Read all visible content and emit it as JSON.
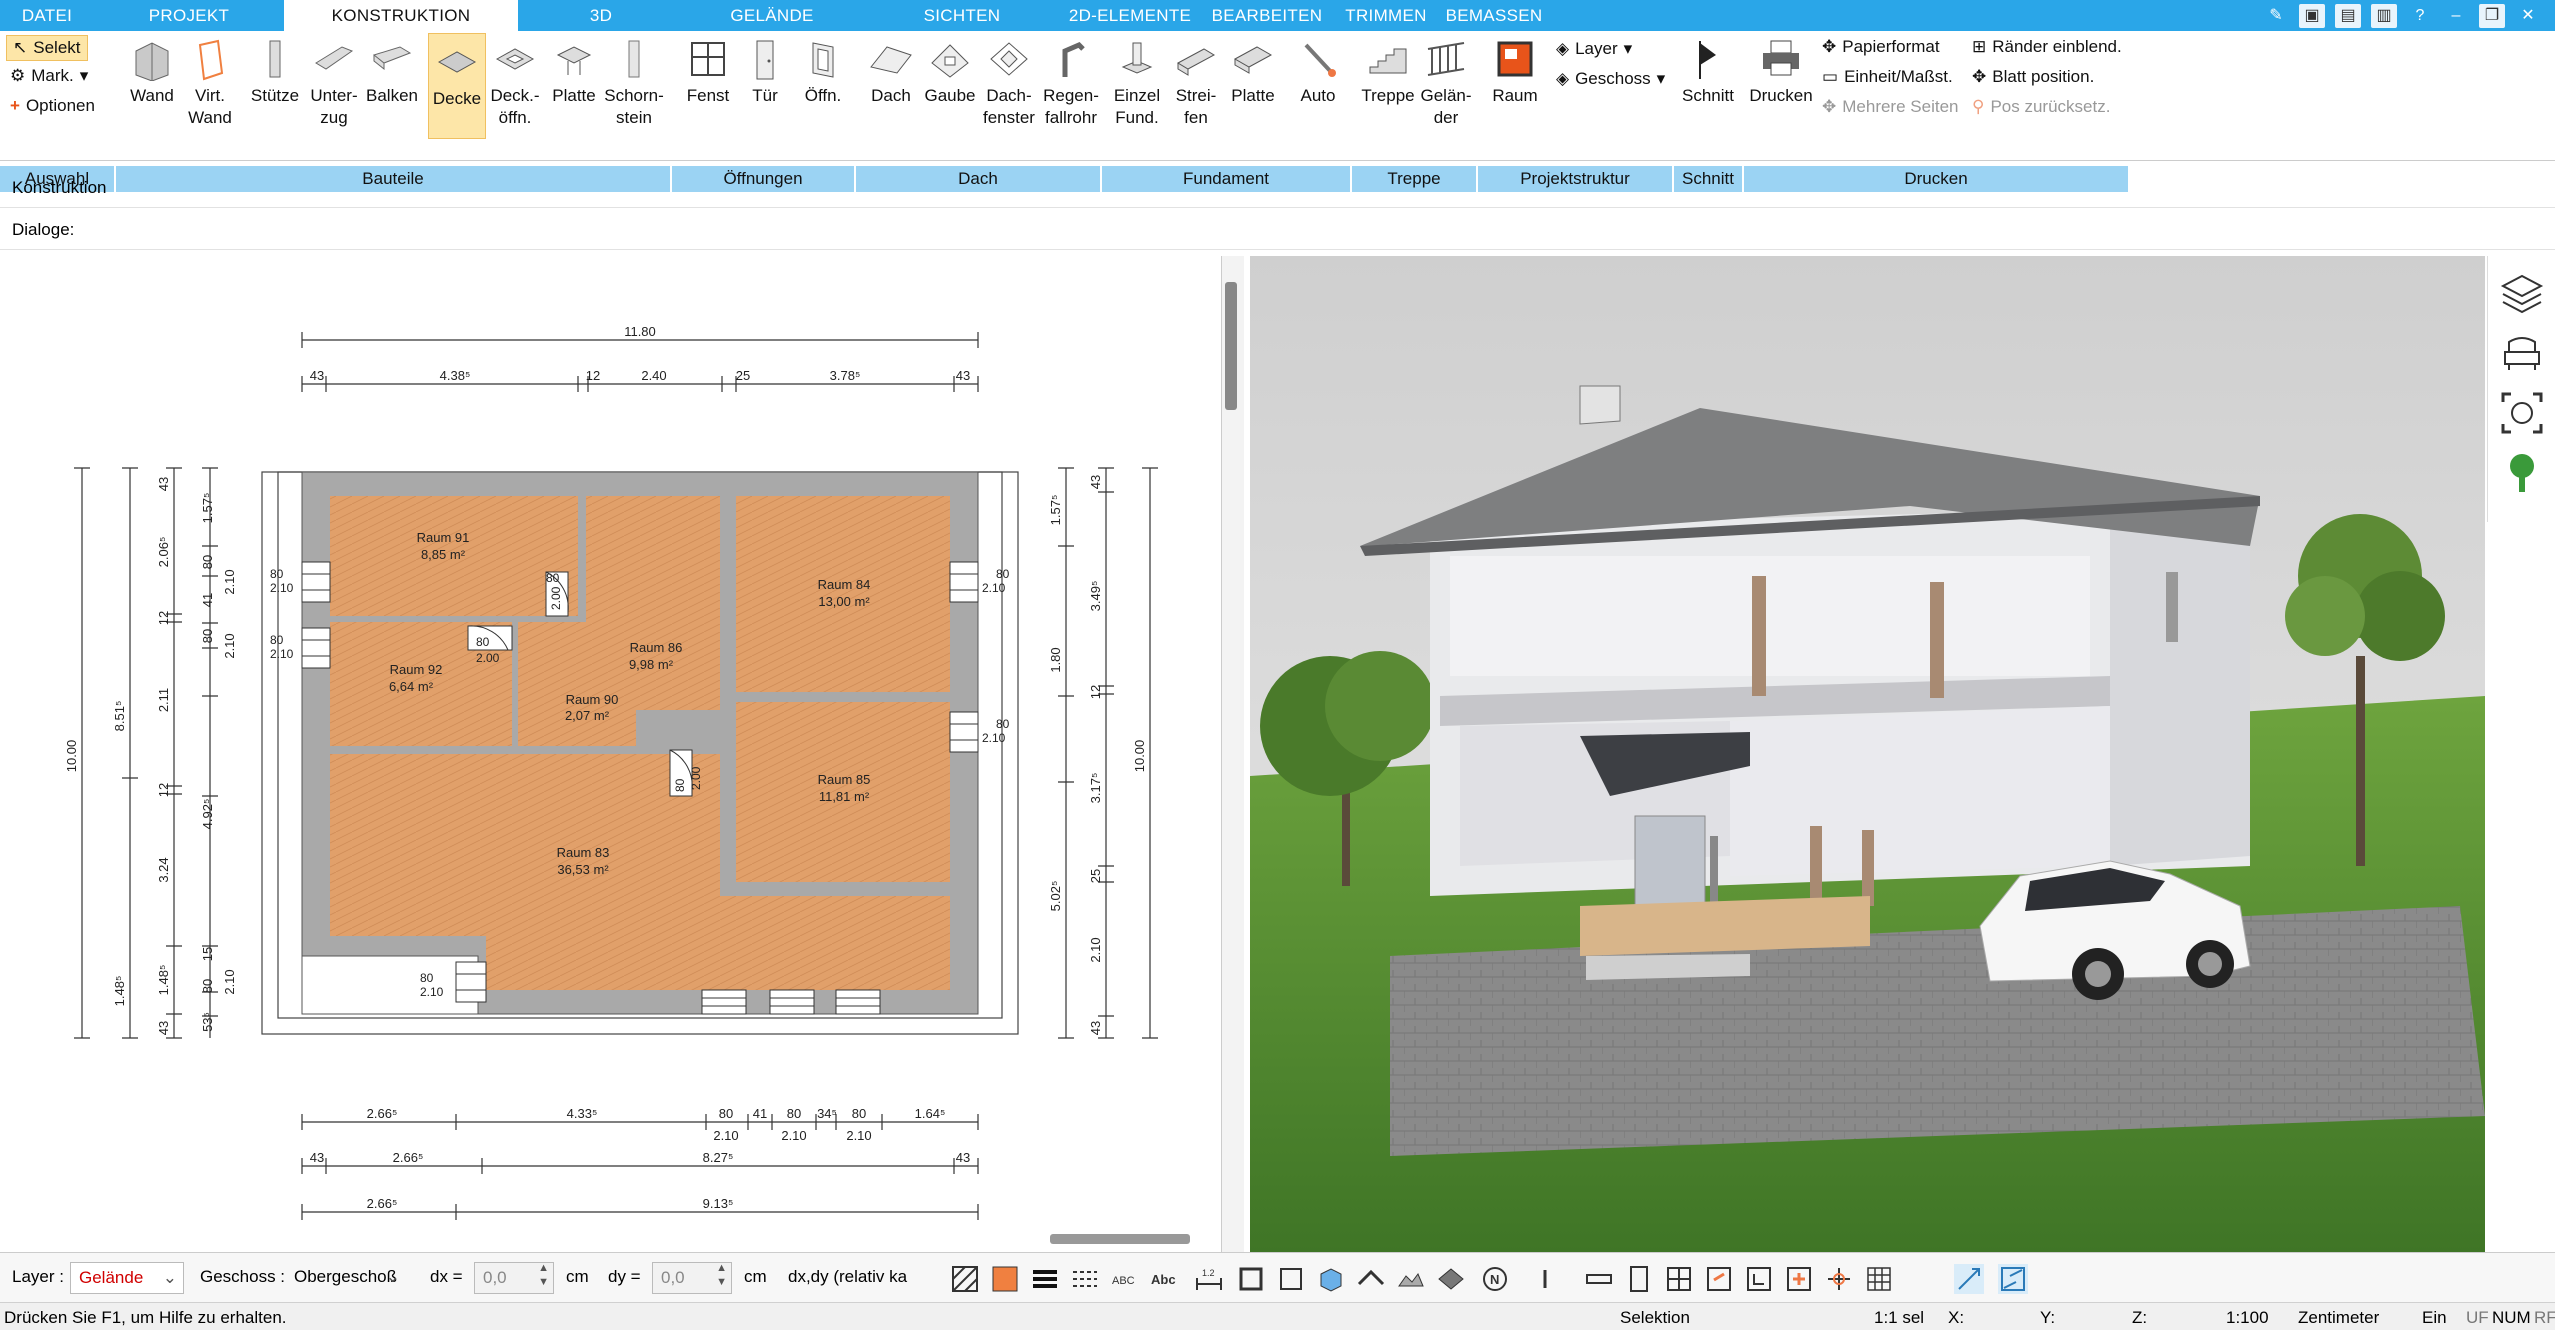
{
  "tabs": [
    "DATEI",
    "PROJEKT",
    "KONSTRUKTION",
    "3D",
    "GELÄNDE",
    "SICHTEN",
    "2D-ELEMENTE",
    "BEARBEITEN",
    "TRIMMEN",
    "BEMASSEN"
  ],
  "active_tab": "KONSTRUKTION",
  "auswahl": {
    "selekt": "Selekt",
    "mark": "Mark.",
    "optionen": "Optionen"
  },
  "buttons": {
    "wand": "Wand",
    "virt_wand": "Virt. Wand",
    "stuetze": "Stütze",
    "unterzug": "Unter- zug",
    "balken": "Balken",
    "decke": "Decke",
    "deckoeffn": "Deck.- öffn.",
    "platte": "Platte",
    "schornstein": "Schorn- stein",
    "fenst": "Fenst",
    "tuer": "Tür",
    "oeffn": "Öffn.",
    "dach": "Dach",
    "gaube": "Gaube",
    "dachfenster": "Dach- fenster",
    "regenfallrohr": "Regen- fallrohr",
    "einzel_fund": "Einzel Fund.",
    "streifen": "Strei- fen",
    "platte2": "Platte",
    "auto": "Auto",
    "treppe": "Treppe",
    "gelaender": "Gelän- der",
    "raum": "Raum",
    "layer": "Layer",
    "geschoss": "Geschoss",
    "schnitt": "Schnitt",
    "drucken": "Drucken",
    "papierformat": "Papierformat",
    "einheit": "Einheit/Maßst.",
    "mehrere_seiten": "Mehrere Seiten",
    "raender": "Ränder einblend.",
    "blatt": "Blatt position.",
    "pos_zurueck": "Pos zurücksetz."
  },
  "groups": [
    "Auswahl",
    "Bauteile",
    "Öffnungen",
    "Dach",
    "Fundament",
    "Treppe",
    "Projektstruktur",
    "Schnitt",
    "Drucken"
  ],
  "rows": {
    "konstruktion": "Konstruktion",
    "dialoge": "Dialoge:"
  },
  "rooms": [
    {
      "name": "Raum 91",
      "area": "8,85 m²"
    },
    {
      "name": "Raum 86",
      "area": "9,98 m²"
    },
    {
      "name": "Raum 84",
      "area": "13,00 m²"
    },
    {
      "name": "Raum 92",
      "area": "6,64 m²"
    },
    {
      "name": "Raum 90",
      "area": "2,07 m²"
    },
    {
      "name": "Raum 85",
      "area": "11,81 m²"
    },
    {
      "name": "Raum 83",
      "area": "36,53 m²"
    }
  ],
  "dims": {
    "top_total": "11.80",
    "top_row": [
      "43",
      "4.38⁵",
      "12",
      "2.40",
      "25",
      "3.78⁵",
      "43"
    ],
    "bottom_row1": [
      "2.66⁵",
      "4.33⁵",
      "80",
      "41",
      "80",
      "34⁵",
      "80",
      "1.64⁵"
    ],
    "bottom_row1b": [
      "2.10",
      "2.10",
      "2.10"
    ],
    "bottom_row2": [
      "43",
      "2.66⁵",
      "8.27⁵",
      "43"
    ],
    "bottom_row3": [
      "2.66⁵",
      "9.13⁵"
    ],
    "left_total": "10.00",
    "left_mid": "8.51⁵",
    "left_col2": [
      "1.48⁵"
    ],
    "left_inner": [
      "43",
      "2.06⁵",
      "12",
      "2.11",
      "12",
      "3.24",
      "1.48⁵",
      "43"
    ],
    "left_inner2": [
      "1.57⁵",
      "80",
      "41",
      "80",
      "4.92⁵",
      "15",
      "80",
      "53⁵"
    ],
    "left_inner3": [
      "2.10",
      "2.10",
      "2.10"
    ],
    "right_total": "10.00",
    "right_col1": [
      "1.57⁵",
      "1.80",
      "5.02⁵"
    ],
    "right_col2": [
      "43",
      "3.49⁵",
      "12",
      "3.17⁵",
      "25",
      "2.10",
      "43"
    ],
    "door_labels": [
      "80",
      "2.00",
      "80",
      "2.00",
      "80",
      "2.00"
    ],
    "window_labels": [
      "80",
      "2.10",
      "80",
      "2.10",
      "80",
      "2.10",
      "80",
      "2.10",
      "80",
      "2.10"
    ]
  },
  "bottom": {
    "layer_label": "Layer :",
    "layer_value": "Gelände",
    "geschoss_label": "Geschoss :",
    "geschoss_value": "Obergeschoß",
    "dx_label": "dx =",
    "dx_value": "0,0",
    "dx_unit": "cm",
    "dy_label": "dy =",
    "dy_value": "0,0",
    "dy_unit": "cm",
    "mode_value": "dx,dy (relativ ka"
  },
  "status": {
    "help": "Drücken Sie F1, um Hilfe zu erhalten.",
    "mode": "Selektion",
    "scale_sel": "1:1 sel",
    "x": "X:",
    "y": "Y:",
    "z": "Z:",
    "scale": "1:100",
    "unit": "Zentimeter",
    "ein": "Ein",
    "uf": "UF",
    "num": "NUM",
    "rf": "RF"
  },
  "colors": {
    "ribbon_blue": "#2aa6e8",
    "group_blue": "#9bd3f3",
    "floor_wood": "#e1a06a",
    "wall_gray": "#a9a9a9",
    "layer_red": "#d00000",
    "grass": "#4e8a2e"
  }
}
